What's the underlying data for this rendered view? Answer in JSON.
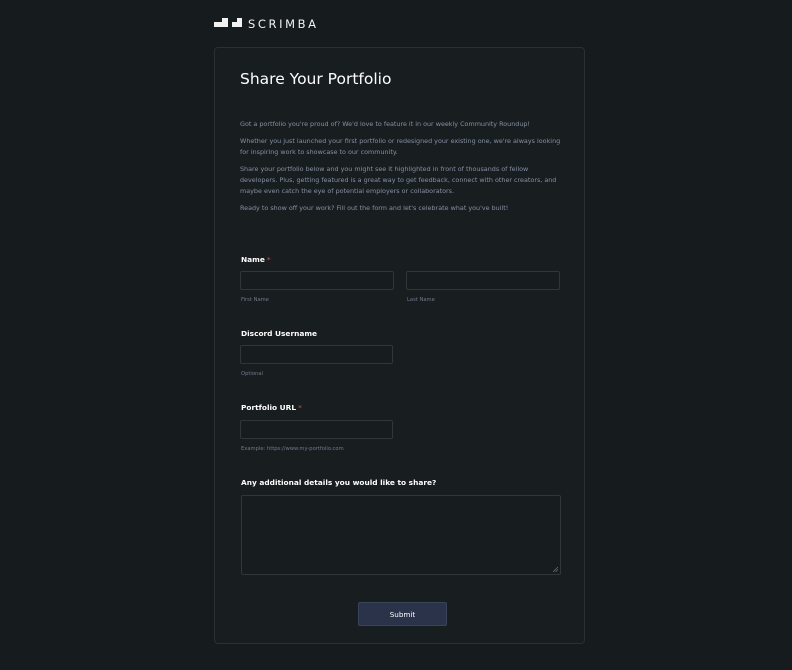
{
  "brand": {
    "name": "SCRIMBA"
  },
  "form": {
    "title": "Share Your Portfolio",
    "intro": [
      "Got a portfolio you're proud of? We'd love to feature it in our weekly Community Roundup!",
      "Whether you just launched your first portfolio or redesigned your existing one, we're always looking for inspiring work to showcase to our community.",
      "Share your portfolio below and you might see it highlighted in front of thousands of fellow developers. Plus, getting featured is a great way to get feedback, connect with other creators, and maybe even catch the eye of potential employers or collaborators.",
      "Ready to show off your work? Fill out the form and let's celebrate what you've built!"
    ],
    "name": {
      "label": "Name",
      "required_mark": "*",
      "first_hint": "First Name",
      "last_hint": "Last Name",
      "first_value": "",
      "last_value": ""
    },
    "discord": {
      "label": "Discord Username",
      "hint": "Optional",
      "value": ""
    },
    "portfolio": {
      "label": "Portfolio URL",
      "required_mark": "*",
      "hint": "Example: https://www.my-portfolio.com",
      "value": ""
    },
    "details": {
      "label": "Any additional details you would like to share?",
      "value": ""
    },
    "submit_label": "Submit"
  },
  "colors": {
    "background": "#161b1d",
    "card": "#181d20",
    "button": "#2a3349",
    "required": "#d94e4e",
    "muted_text": "#8690a3"
  },
  "icons": [
    "scrimba-logo-icon",
    "resize-handle-icon"
  ]
}
